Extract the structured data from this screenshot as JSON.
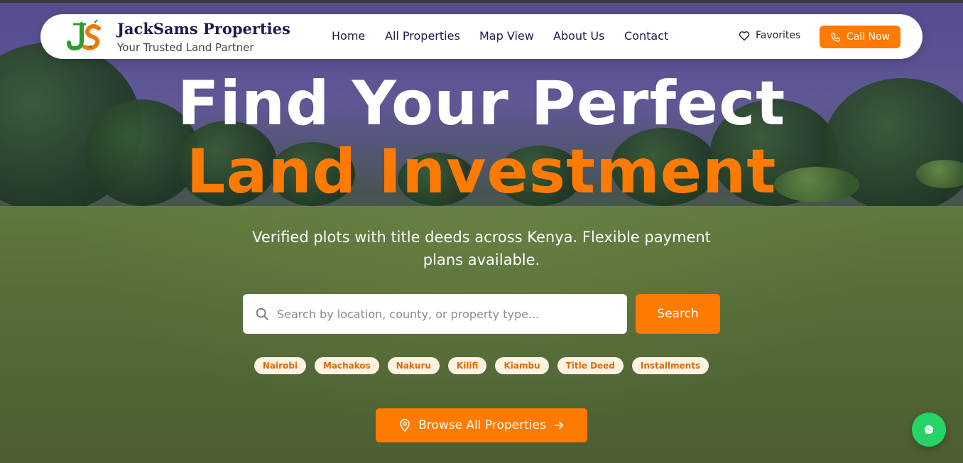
{
  "header": {
    "brand_name": "JackSams Properties",
    "tagline": "Your Trusted Land Partner",
    "logo_text": "JS",
    "nav": [
      {
        "label": "Home"
      },
      {
        "label": "All Properties"
      },
      {
        "label": "Map View"
      },
      {
        "label": "About Us"
      },
      {
        "label": "Contact"
      }
    ],
    "favorites_label": "Favorites",
    "call_label": "Call Now"
  },
  "hero": {
    "headline_line1": "Find Your Perfect",
    "headline_line2": "Land Investment",
    "subtitle": "Verified plots with title deeds across Kenya. Flexible payment plans available."
  },
  "search": {
    "placeholder": "Search by location, county, or property type...",
    "value": "",
    "button_label": "Search"
  },
  "quick_tags": [
    "Nairobi",
    "Machakos",
    "Nakuru",
    "Kilifi",
    "Kiambu",
    "Title Deed",
    "Installments"
  ],
  "browse_label": "Browse All Properties",
  "icons": {
    "favorites": "heart-icon",
    "call": "phone-icon",
    "search": "search-icon",
    "browse": "map-pin-icon",
    "browse_arrow": "arrow-right-icon",
    "chat": "whatsapp-icon"
  },
  "colors": {
    "accent": "#ff7a00",
    "brand_text": "#1f1a4d",
    "tag_bg": "#fdf3e3",
    "whatsapp": "#25d366"
  }
}
